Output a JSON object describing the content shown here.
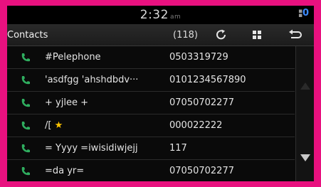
{
  "status": {
    "time": "2:32",
    "ampm": "am",
    "notification_count": "0"
  },
  "toolbar": {
    "title": "Contacts",
    "count": "(118)",
    "refresh_icon": "refresh-icon",
    "grid_icon": "grid-icon",
    "back_icon": "back-icon"
  },
  "contacts": [
    {
      "name": "#Pelephone",
      "number": "0503319729"
    },
    {
      "name": "'asdfgg 'ahshdbdv···",
      "number": "0101234567890"
    },
    {
      "name": "+ yjlee +",
      "number": "07050702277"
    },
    {
      "name": "/[",
      "star": "★",
      "number": "000022222"
    },
    {
      "name": "= Yyyy =iwisidiwjejj",
      "number": "117"
    },
    {
      "name": "=da yr=",
      "number": "07050702277"
    }
  ],
  "colors": {
    "frame": "#e8117f",
    "phone_icon": "#2fae5f",
    "star": "#ffc400",
    "badge": "#3d8bff"
  }
}
